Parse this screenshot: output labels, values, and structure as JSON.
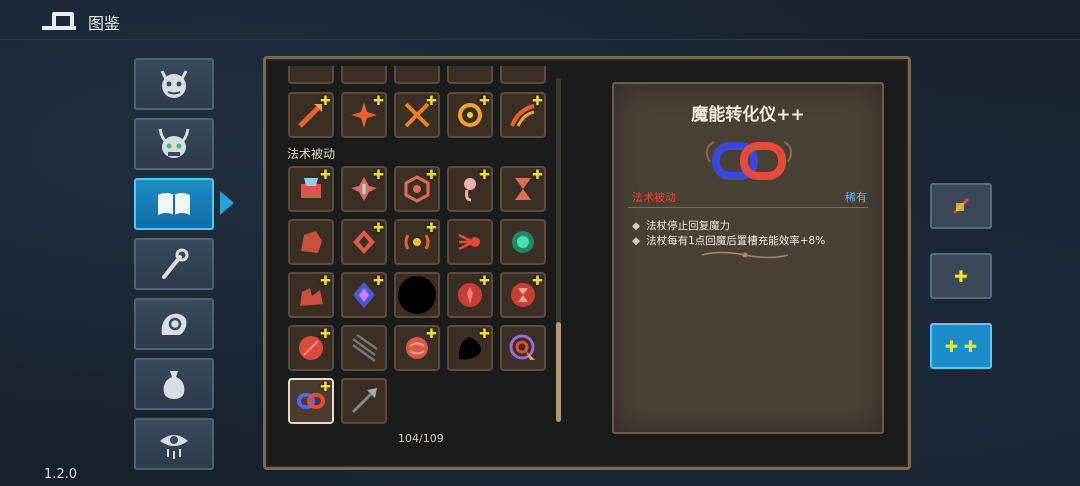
{
  "header": {
    "title": "图鉴"
  },
  "version": "1.2.0",
  "sidebar": {
    "tabs": [
      {
        "icon": "demon-face-icon"
      },
      {
        "icon": "horned-monster-icon"
      },
      {
        "icon": "open-book-icon",
        "active": true
      },
      {
        "icon": "magic-staff-icon"
      },
      {
        "icon": "spell-hand-icon"
      },
      {
        "icon": "potion-bag-icon"
      },
      {
        "icon": "eye-icon"
      }
    ]
  },
  "collection": {
    "section_label": "法术被动",
    "count": "104/109"
  },
  "detail": {
    "name": "魔能转化仪++",
    "type": "法术被动",
    "rarity": "稀有",
    "desc": [
      "法杖停止回复魔力",
      "法杖每有1点回魔后置槽充能效率+8%"
    ]
  },
  "upgrade_buttons": [
    {
      "label": "",
      "icon": "crossed-out-icon"
    },
    {
      "label": "✚",
      "icon": "single-plus-icon"
    },
    {
      "label": "✚ ✚",
      "icon": "double-plus-icon",
      "active": true
    }
  ],
  "colors": {
    "accent": "#1a8cc8",
    "plus_yellow": "#f2e12a",
    "type_red": "#e8463a",
    "rarity_blue": "#5fb7f0"
  }
}
